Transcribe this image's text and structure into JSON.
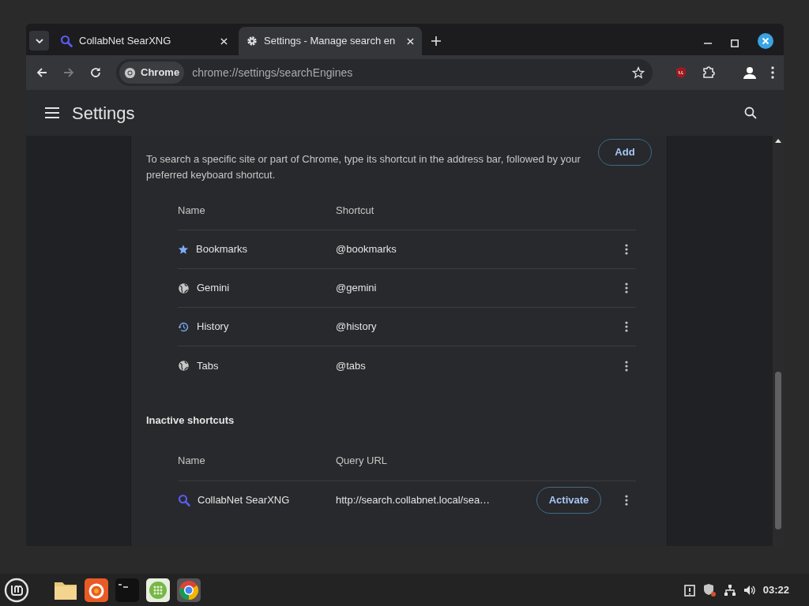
{
  "tabs": [
    {
      "title": "CollabNet SearXNG",
      "kind": "search",
      "selected": false
    },
    {
      "title": "Settings - Manage search en",
      "kind": "gear",
      "selected": true
    }
  ],
  "toolbar": {
    "site_chip": "Chrome",
    "url": "chrome://settings/searchEngines"
  },
  "header": {
    "title": "Settings"
  },
  "site_search": {
    "description": "To search a specific site or part of Chrome, type its shortcut in the address bar, followed by your preferred keyboard shortcut.",
    "add_button": "Add",
    "columns": [
      "Name",
      "Shortcut"
    ],
    "rows": [
      {
        "kind": "star",
        "name": "Bookmarks",
        "shortcut": "@bookmarks"
      },
      {
        "kind": "globe",
        "name": "Gemini",
        "shortcut": "@gemini"
      },
      {
        "kind": "history",
        "name": "History",
        "shortcut": "@history"
      },
      {
        "kind": "globe",
        "name": "Tabs",
        "shortcut": "@tabs"
      }
    ]
  },
  "inactive": {
    "title": "Inactive shortcuts",
    "columns": [
      "Name",
      "Query URL"
    ],
    "rows": [
      {
        "kind": "search",
        "name": "CollabNet SearXNG",
        "query_url": "http://search.collabnet.local/sea…",
        "button": "Activate"
      }
    ]
  },
  "taskbar": {
    "clock": "03:22"
  }
}
